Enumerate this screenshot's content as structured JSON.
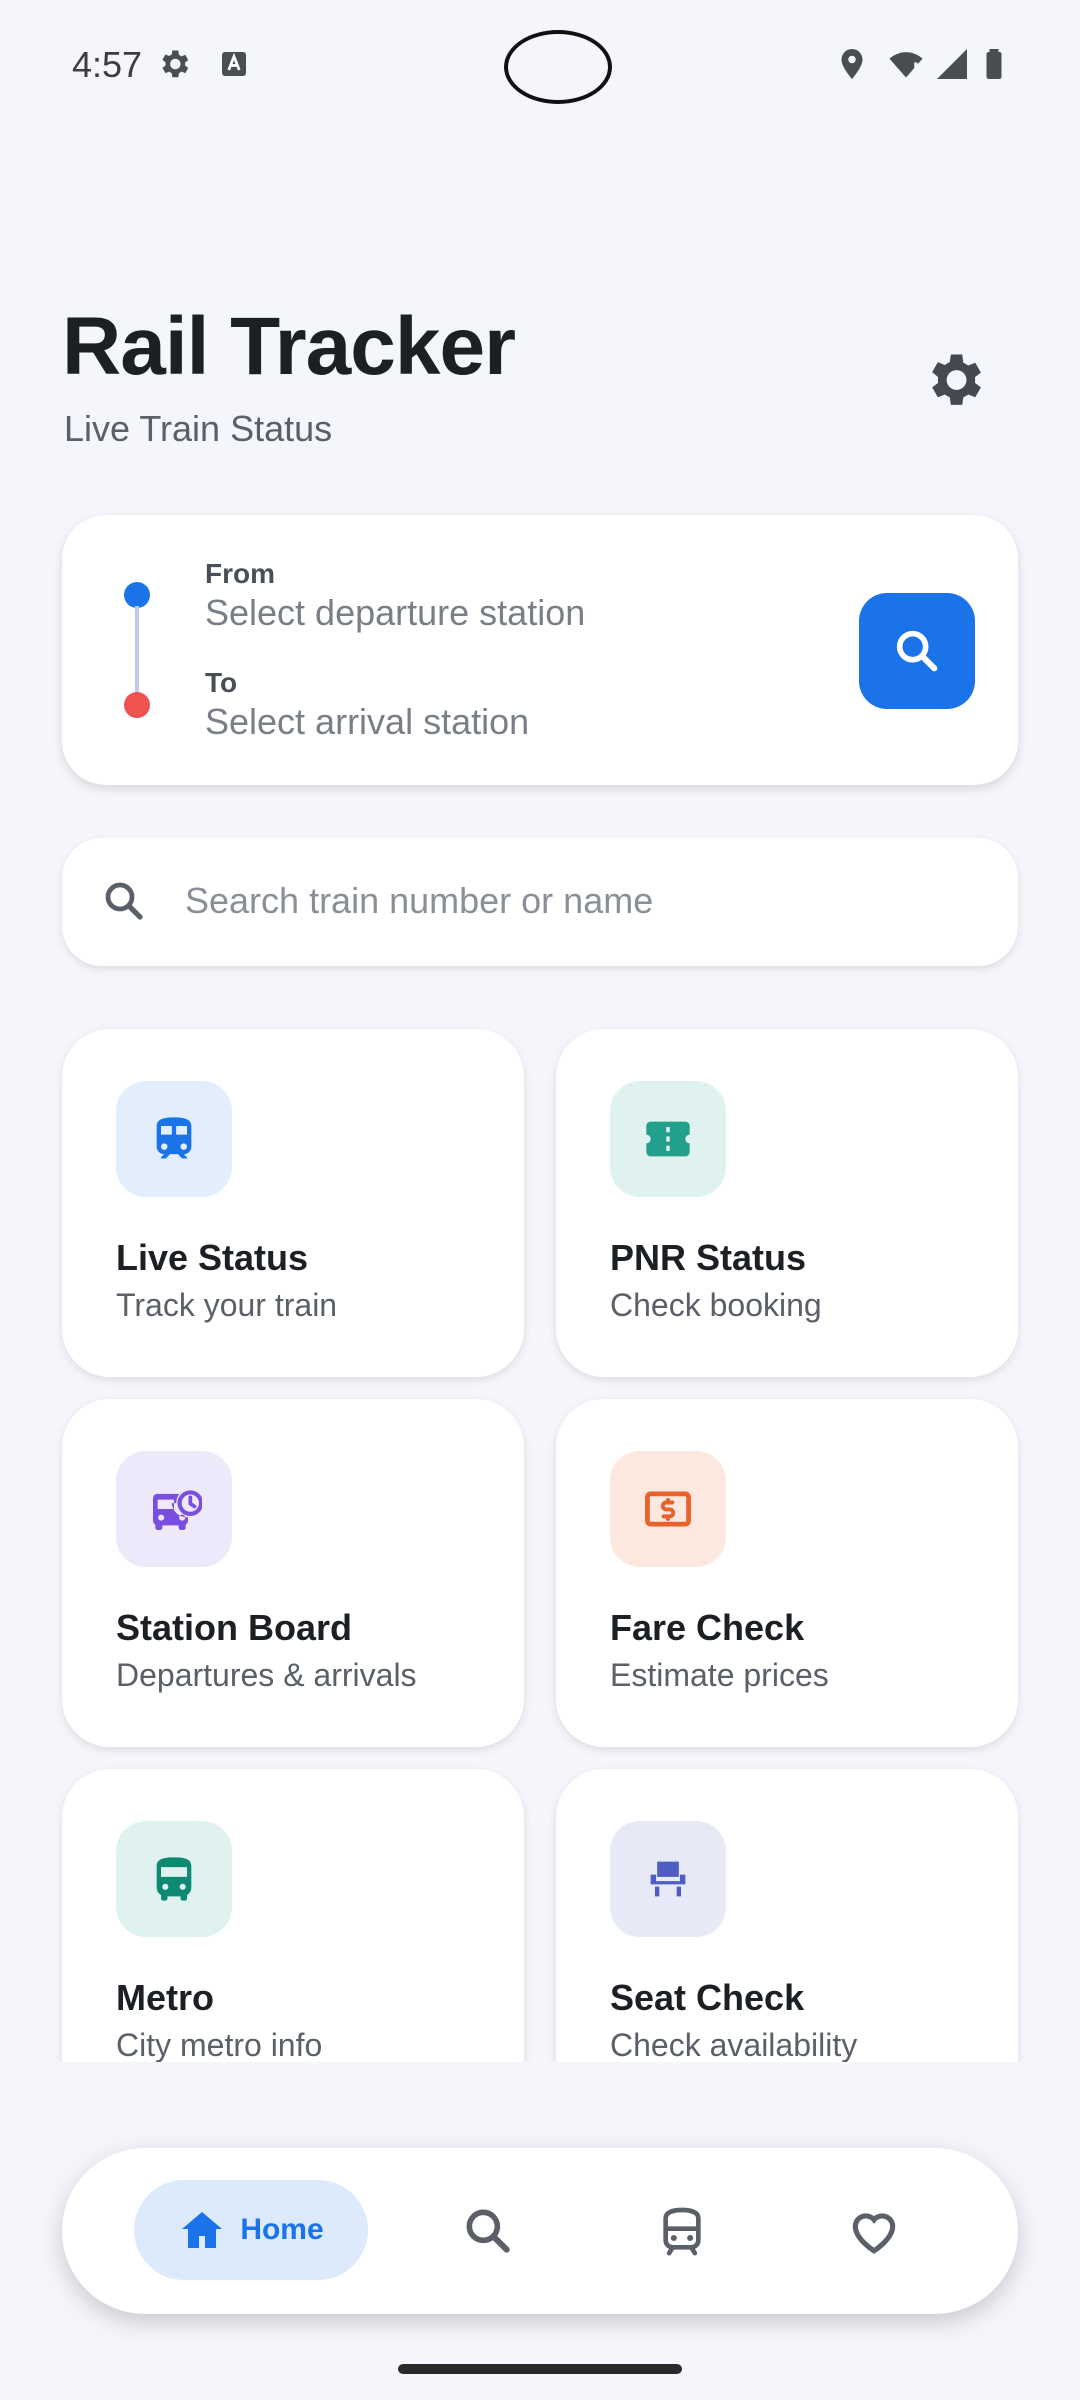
{
  "status_bar": {
    "time": "4:57"
  },
  "header": {
    "title": "Rail Tracker",
    "subtitle": "Live Train Status"
  },
  "route": {
    "from_label": "From",
    "from_placeholder": "Select departure station",
    "to_label": "To",
    "to_placeholder": "Select arrival station"
  },
  "search": {
    "placeholder": "Search train number or name"
  },
  "features": [
    {
      "title": "Live Status",
      "subtitle": "Track your train",
      "icon": "train-icon",
      "bg": "#e3eefc",
      "color": "#1a73e8"
    },
    {
      "title": "PNR Status",
      "subtitle": "Check booking",
      "icon": "ticket-icon",
      "bg": "#e0f2ef",
      "color": "#23a08c"
    },
    {
      "title": "Station Board",
      "subtitle": "Departures & arrivals",
      "icon": "departure-board-icon",
      "bg": "#eee8fb",
      "color": "#7a4fe0"
    },
    {
      "title": "Fare Check",
      "subtitle": "Estimate prices",
      "icon": "fare-icon",
      "bg": "#fde8df",
      "color": "#e8622a"
    },
    {
      "title": "Metro",
      "subtitle": "City metro info",
      "icon": "metro-icon",
      "bg": "#e0f2ef",
      "color": "#0f8a72"
    },
    {
      "title": "Seat Check",
      "subtitle": "Check availability",
      "icon": "seat-icon",
      "bg": "#e7e9f7",
      "color": "#4e5cc4"
    }
  ],
  "nav": {
    "home_label": "Home",
    "active": "home"
  },
  "colors": {
    "accent": "#1a73e8",
    "from_dot": "#1a73e8",
    "to_dot": "#ef5350",
    "background": "#f4f6fb"
  }
}
